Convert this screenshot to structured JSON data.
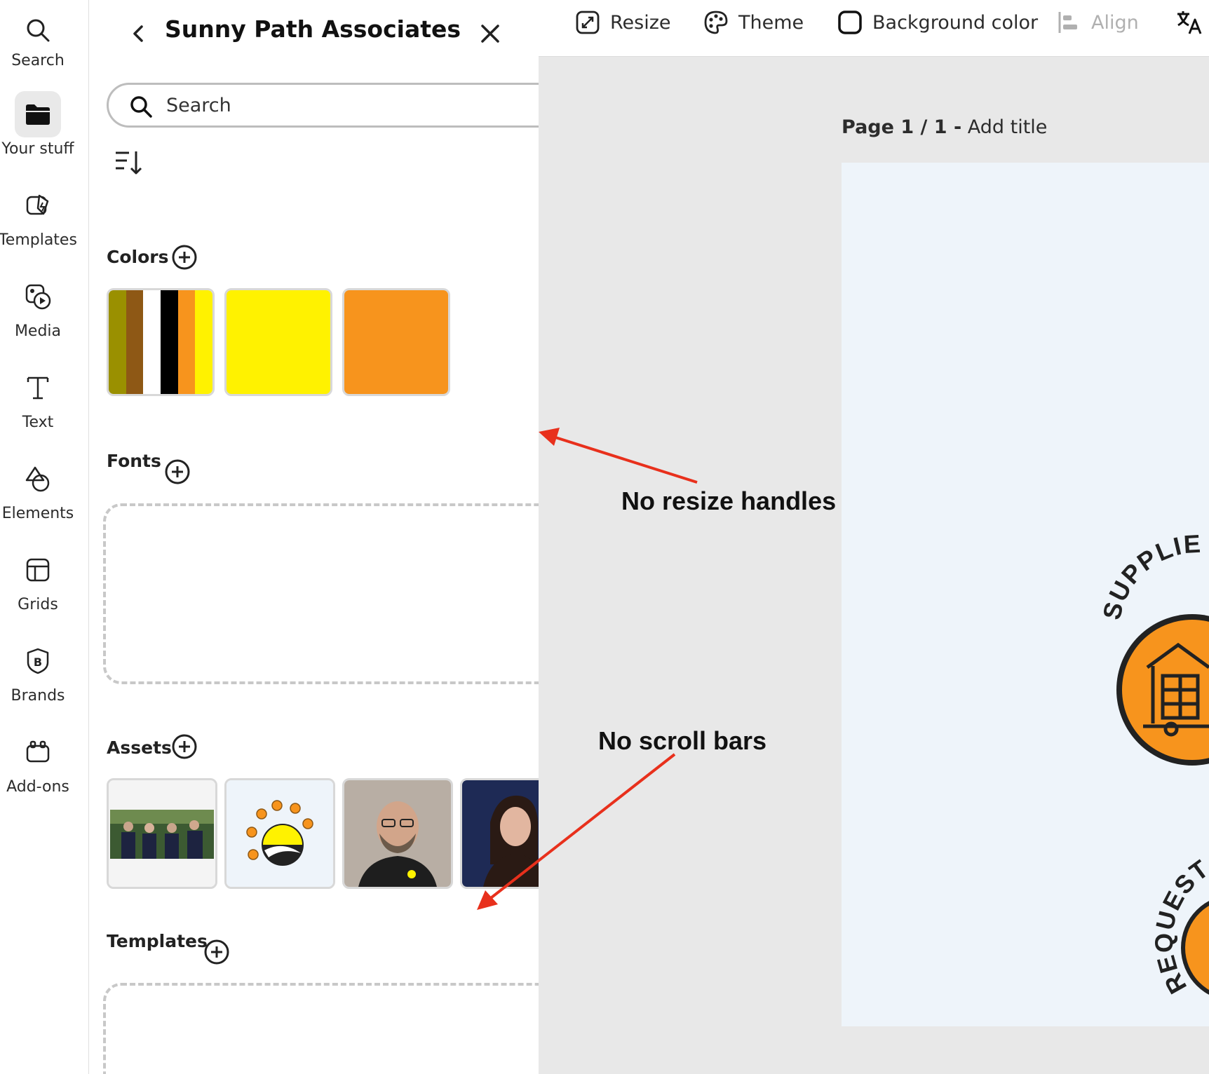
{
  "rail": {
    "items": [
      {
        "label": "Search",
        "icon": "search-icon"
      },
      {
        "label": "Your stuff",
        "icon": "folder-icon",
        "active": true
      },
      {
        "label": "Templates",
        "icon": "templates-icon"
      },
      {
        "label": "Media",
        "icon": "media-icon"
      },
      {
        "label": "Text",
        "icon": "text-icon"
      },
      {
        "label": "Elements",
        "icon": "elements-icon"
      },
      {
        "label": "Grids",
        "icon": "grids-icon"
      },
      {
        "label": "Brands",
        "icon": "brands-icon"
      },
      {
        "label": "Add-ons",
        "icon": "addons-icon"
      }
    ]
  },
  "panel": {
    "title": "Sunny Path Associates",
    "search_placeholder": "Search",
    "sections": {
      "colors": "Colors",
      "fonts": "Fonts",
      "assets": "Assets",
      "templates": "Templates"
    },
    "colors": {
      "palette_stripes": [
        "#9a9000",
        "#8e5815",
        "#ffffff",
        "#000000",
        "#f7941d",
        "#fff200"
      ],
      "swatch_yellow": "#fff200",
      "swatch_orange": "#f7941d"
    },
    "assets": [
      {
        "name": "team-photo"
      },
      {
        "name": "sunny-path-logo"
      },
      {
        "name": "man-portrait"
      },
      {
        "name": "woman-portrait"
      }
    ]
  },
  "toolbar": {
    "resize": "Resize",
    "theme": "Theme",
    "background_color": "Background color",
    "align": "Align"
  },
  "canvas": {
    "page_label_bold": "Page 1 / 1 -",
    "page_label_title": "Add title",
    "curved_text_1": "SUPPLIE",
    "curved_text_2": "REQUEST",
    "accent": "#f7941d"
  },
  "annotations": {
    "note_1": "No resize handles",
    "note_2": "No scroll bars",
    "arrow_color": "#e8301c"
  }
}
